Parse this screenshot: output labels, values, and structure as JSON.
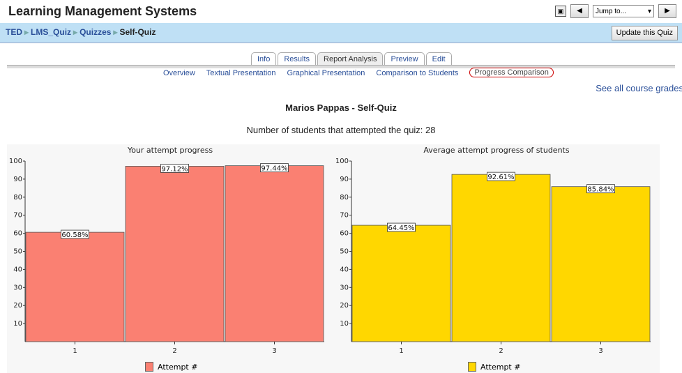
{
  "header": {
    "title": "Learning Management Systems",
    "jump_label": "Jump to..."
  },
  "breadcrumb": [
    "TED",
    "LMS_Quiz",
    "Quizzes",
    "Self-Quiz"
  ],
  "update_button": "Update this Quiz",
  "tabs": [
    {
      "label": "Info"
    },
    {
      "label": "Results"
    },
    {
      "label": "Report Analysis",
      "active": true
    },
    {
      "label": "Preview"
    },
    {
      "label": "Edit"
    }
  ],
  "subtabs": [
    {
      "label": "Overview"
    },
    {
      "label": "Textual Presentation"
    },
    {
      "label": "Graphical Presentation"
    },
    {
      "label": "Comparison to Students"
    },
    {
      "label": "Progress Comparison",
      "active": true
    }
  ],
  "see_all": "See all course grades",
  "heading": "Marios Pappas - Self-Quiz",
  "attempt_count": "Number of students that attempted the quiz: 28",
  "chart_data": [
    {
      "type": "bar",
      "title": "Your attempt progress",
      "categories": [
        "1",
        "2",
        "3"
      ],
      "values": [
        60.58,
        97.12,
        97.44
      ],
      "labels": [
        "60.58%",
        "97.12%",
        "97.44%"
      ],
      "ylim": [
        0,
        100
      ],
      "yticks": [
        10,
        20,
        30,
        40,
        50,
        60,
        70,
        80,
        90,
        100
      ],
      "legend": "Attempt #",
      "color": "#fa8072"
    },
    {
      "type": "bar",
      "title": "Average attempt progress of students",
      "categories": [
        "1",
        "2",
        "3"
      ],
      "values": [
        64.45,
        92.61,
        85.84
      ],
      "labels": [
        "64.45%",
        "92.61%",
        "85.84%"
      ],
      "ylim": [
        0,
        100
      ],
      "yticks": [
        10,
        20,
        30,
        40,
        50,
        60,
        70,
        80,
        90,
        100
      ],
      "legend": "Attempt #",
      "color": "#ffd700"
    }
  ]
}
